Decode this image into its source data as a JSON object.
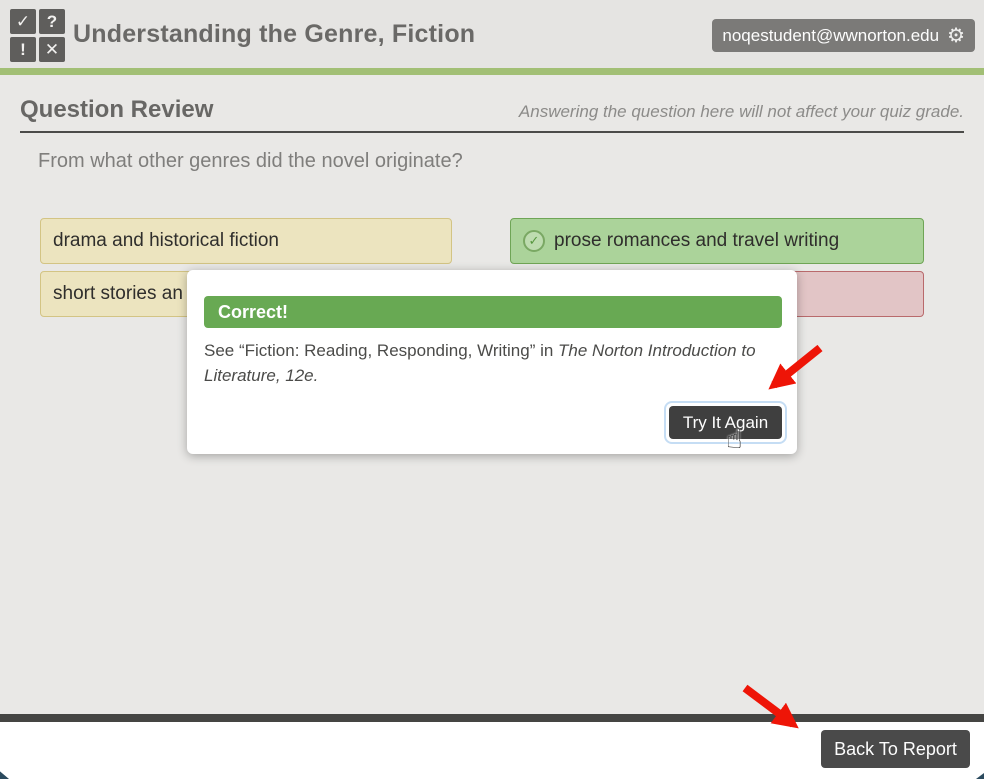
{
  "header": {
    "title": "Understanding the Genre, Fiction",
    "account_email": "noqestudent@wwnorton.edu",
    "gear_icon": "⚙",
    "logo": {
      "check": "✓",
      "question": "?",
      "exclaim": "!",
      "cross": "✕"
    }
  },
  "review": {
    "heading": "Question Review",
    "grade_note": "Answering the question here will not affect your quiz grade.",
    "question": "From what other genres did the novel originate?"
  },
  "options": [
    {
      "label": "drama and historical fiction",
      "state": "neutral"
    },
    {
      "label": "prose romances and travel writing",
      "state": "correct",
      "correct_icon": "✓"
    },
    {
      "label": "short stories an",
      "state": "neutral"
    },
    {
      "label": "",
      "state": "incorrect"
    }
  ],
  "modal": {
    "status_label": "Correct!",
    "body_prefix": "See “Fiction: Reading, Responding, Writing” in ",
    "body_citation": "The Norton Introduction to Literature, 12e",
    "body_suffix": ".",
    "try_again_label": "Try It Again",
    "cursor_icon": "☝"
  },
  "footer": {
    "back_to_report_label": "Back To Report"
  },
  "colors": {
    "brand_green_bar": "#a2bf75",
    "correct_banner_green": "#68a953",
    "correct_option_bg": "#abd39a",
    "correct_option_border": "#6fa556",
    "neutral_option_bg": "#ece4bf",
    "neutral_option_border": "#d3c484",
    "incorrect_option_bg": "#e2c5c6",
    "incorrect_option_border": "#b96a6c",
    "dark_button": "#3f3f3f",
    "focus_ring_blue": "#c5ddf4",
    "annotation_arrow_red": "#ee1507"
  }
}
